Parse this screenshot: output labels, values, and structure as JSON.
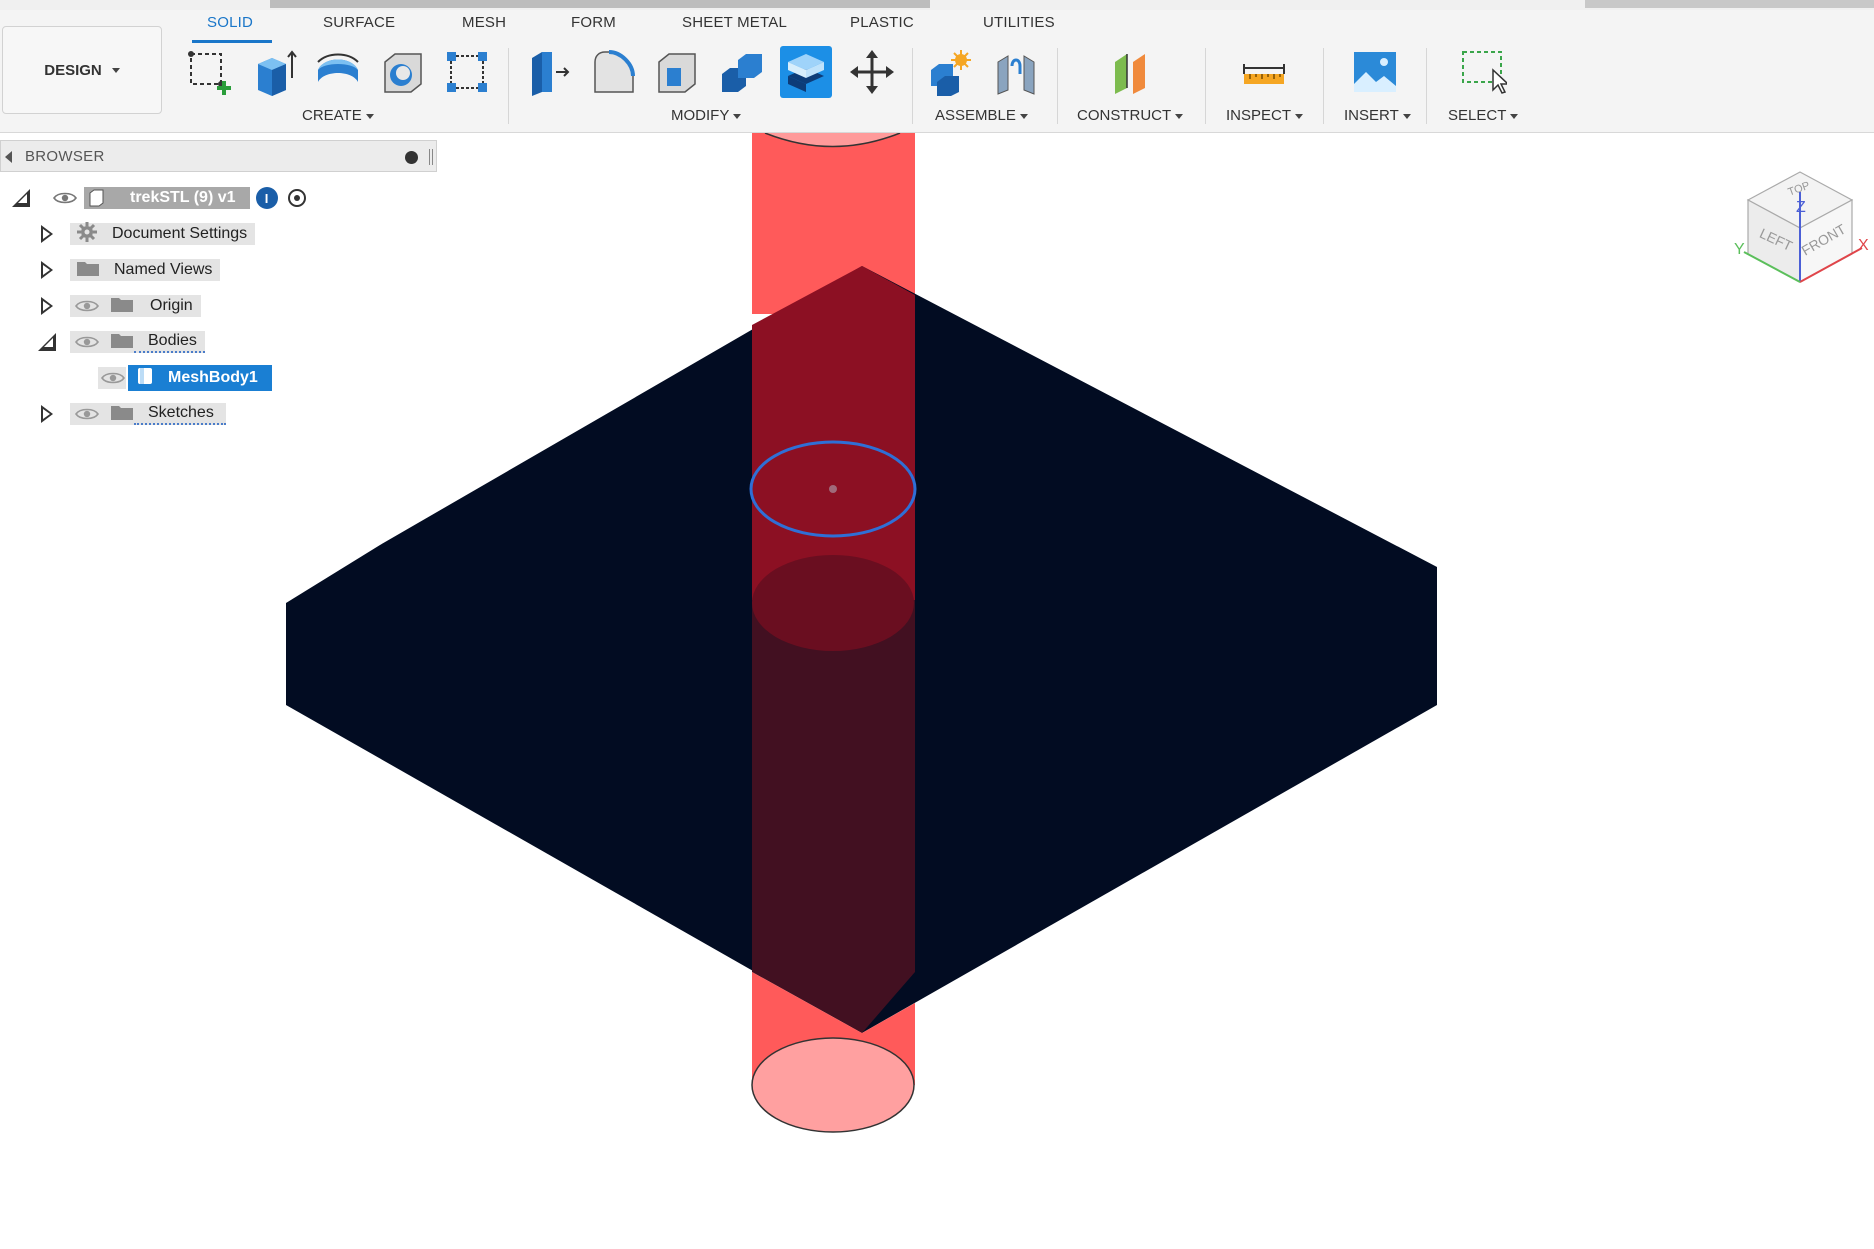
{
  "tabs": [
    "SOLID",
    "SURFACE",
    "MESH",
    "FORM",
    "SHEET METAL",
    "PLASTIC",
    "UTILITIES"
  ],
  "active_tab": "SOLID",
  "workspace": {
    "label": "DESIGN"
  },
  "toolbar_groups": {
    "create": "CREATE",
    "modify": "MODIFY",
    "assemble": "ASSEMBLE",
    "construct": "CONSTRUCT",
    "inspect": "INSPECT",
    "insert": "INSERT",
    "select": "SELECT"
  },
  "tool_icons": {
    "create": [
      "new-sketch-icon",
      "extrude-icon",
      "revolve-icon",
      "hole-icon",
      "pattern-icon"
    ],
    "modify": [
      "press-pull-icon",
      "fillet-icon",
      "shell-icon",
      "combine-icon",
      "offset-face-icon",
      "move-icon"
    ],
    "assemble": [
      "new-component-icon",
      "joint-icon"
    ],
    "construct": [
      "plane-icon"
    ],
    "inspect": [
      "measure-icon"
    ],
    "insert": [
      "insert-image-icon"
    ],
    "select": [
      "window-select-icon"
    ]
  },
  "browser": {
    "title": "BROWSER",
    "root": "trekSTL (9) v1",
    "items": [
      {
        "label": "Document Settings",
        "icon": "gear-icon"
      },
      {
        "label": "Named Views",
        "icon": "folder-icon"
      },
      {
        "label": "Origin",
        "icon": "folder-icon"
      },
      {
        "label": "Bodies",
        "icon": "folder-icon",
        "expanded": true
      },
      {
        "label": "MeshBody1",
        "icon": "body-icon",
        "selected": true
      },
      {
        "label": "Sketches",
        "icon": "folder-icon"
      }
    ]
  },
  "viewcube": {
    "top": "TOP",
    "left": "LEFT",
    "front": "FRONT",
    "axis_x": "X",
    "axis_y": "Y",
    "axis_z": "Z"
  },
  "colors": {
    "accent": "#1a7fd3",
    "plate": "#020c22",
    "cylinder": "#ff5a5a",
    "cylinder_overlap": "#8c1023",
    "selection_edge": "#2f6fd6"
  }
}
